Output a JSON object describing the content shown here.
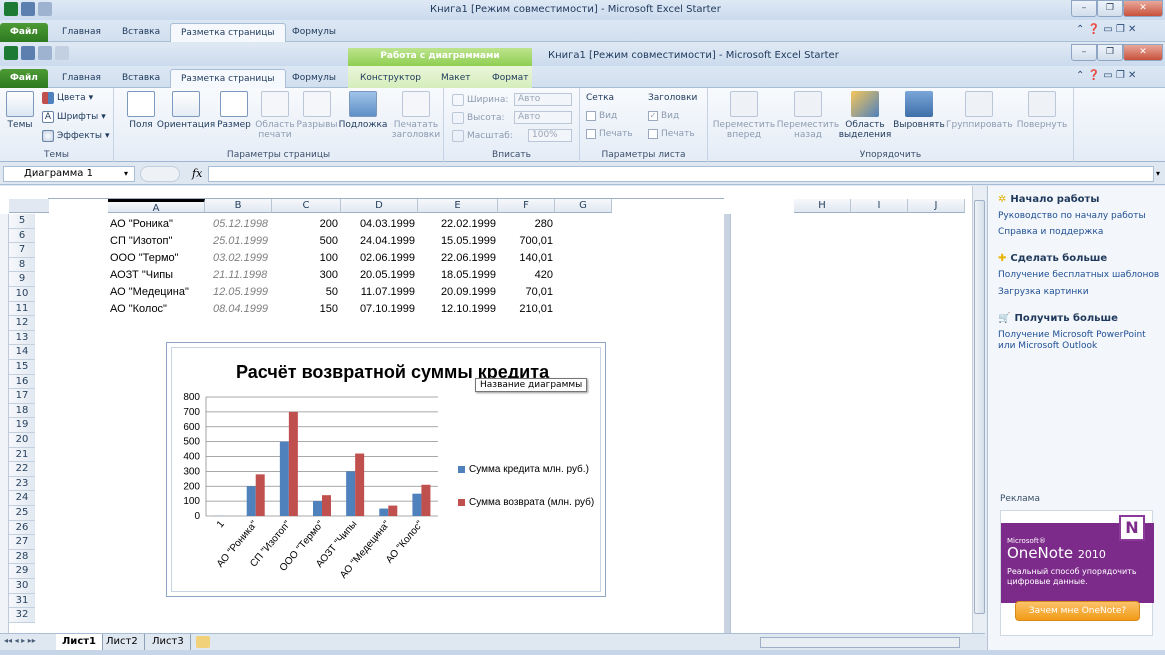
{
  "back_window": {
    "title": "Книга1  [Режим совместимости]  -  Microsoft Excel Starter",
    "tabs": [
      "Файл",
      "Главная",
      "Вставка",
      "Разметка страницы",
      "Формулы"
    ]
  },
  "window": {
    "title": "Книга1  [Режим совместимости]  -  Microsoft Excel Starter",
    "context_group": "Работа с диаграммами",
    "tabs": [
      "Файл",
      "Главная",
      "Вставка",
      "Разметка страницы",
      "Формулы"
    ],
    "context_tabs": [
      "Конструктор",
      "Макет",
      "Формат"
    ]
  },
  "ribbon": {
    "themes": {
      "label": "Темы",
      "big": "Темы",
      "colors": "Цвета",
      "fonts": "Шрифты",
      "effects": "Эффекты"
    },
    "page_setup": {
      "label": "Параметры страницы",
      "margins": "Поля",
      "orientation": "Ориентация",
      "size": "Размер",
      "print_area": "Область печати",
      "breaks": "Разрывы",
      "background": "Подложка",
      "print_titles": "Печатать заголовки"
    },
    "fit": {
      "label": "Вписать",
      "width": "Ширина:",
      "width_val": "Авто",
      "height": "Высота:",
      "height_val": "Авто",
      "scale": "Масштаб:",
      "scale_val": "100%"
    },
    "sheet_options": {
      "label": "Параметры листа",
      "grid": "Сетка",
      "headings": "Заголовки",
      "view": "Вид",
      "print": "Печать"
    },
    "arrange": {
      "label": "Упорядочить",
      "forward": "Переместить вперед",
      "backward": "Переместить назад",
      "selection": "Область выделения",
      "align": "Выровнять",
      "group": "Группировать",
      "rotate": "Повернуть"
    }
  },
  "formula_bar": {
    "name_box": "Диаграмма 1",
    "fx": "fx"
  },
  "columns": [
    "A",
    "B",
    "C",
    "D",
    "E",
    "F",
    "G",
    "H",
    "I",
    "J"
  ],
  "rows": [
    "5",
    "6",
    "7",
    "8",
    "9",
    "10",
    "11",
    "12",
    "13",
    "14",
    "15",
    "16",
    "17",
    "18",
    "19",
    "20",
    "21",
    "22",
    "23",
    "24",
    "25",
    "26",
    "27",
    "28",
    "29",
    "30",
    "31",
    "32"
  ],
  "table": [
    {
      "name": "АО \"Роника\"",
      "date1": "05.12.1998",
      "amount": "200",
      "date2": "04.03.1999",
      "date3": "22.02.1999",
      "ret": "280"
    },
    {
      "name": "СП \"Изотоп\"",
      "date1": "25.01.1999",
      "amount": "500",
      "date2": "24.04.1999",
      "date3": "15.05.1999",
      "ret": "700,01"
    },
    {
      "name": "ООО \"Термо\"",
      "date1": "03.02.1999",
      "amount": "100",
      "date2": "02.06.1999",
      "date3": "22.06.1999",
      "ret": "140,01"
    },
    {
      "name": "АОЗТ \"Чипы",
      "date1": "21.11.1998",
      "amount": "300",
      "date2": "20.05.1999",
      "date3": "18.05.1999",
      "ret": "420"
    },
    {
      "name": "АО \"Медецина\"",
      "date1": "12.05.1999",
      "amount": "50",
      "date2": "11.07.1999",
      "date3": "20.09.1999",
      "ret": "70,01"
    },
    {
      "name": "АО \"Колос\"",
      "date1": "08.04.1999",
      "amount": "150",
      "date2": "07.10.1999",
      "date3": "12.10.1999",
      "ret": "210,01"
    }
  ],
  "tooltip": "Название диаграммы",
  "chart_data": {
    "type": "bar",
    "title": "Расчёт возвратной суммы кредита",
    "categories": [
      "1",
      "АО \"Роника\"",
      "СП \"Изотоп\"",
      "ООО \"Термо\"",
      "АОЗТ \"Чипы",
      "АО \"Медецина\"",
      "АО \"Колос\""
    ],
    "series": [
      {
        "name": "Сумма кредита млн. руб.)",
        "color": "#4f81bd",
        "values": [
          1,
          200,
          500,
          100,
          300,
          50,
          150
        ]
      },
      {
        "name": "Сумма возврата (млн. руб)",
        "color": "#c0504d",
        "values": [
          0,
          280,
          700.01,
          140.01,
          420,
          70.01,
          210.01
        ]
      }
    ],
    "ylim": [
      0,
      800
    ],
    "yticks": [
      "0",
      "100",
      "200",
      "300",
      "400",
      "500",
      "600",
      "700",
      "800"
    ],
    "grid": true,
    "legend": "right"
  },
  "sheet_tabs": [
    "Лист1",
    "Лист2",
    "Лист3"
  ],
  "side_panel": {
    "h1": "Начало работы",
    "l1": [
      "Руководство по началу работы",
      "Справка и поддержка"
    ],
    "h2": "Сделать больше",
    "l2": [
      "Получение бесплатных шаблонов",
      "Загрузка картинки"
    ],
    "h3": "Получить больше",
    "l3": [
      "Получение Microsoft PowerPoint или Microsoft Outlook"
    ],
    "ad_label": "Реклама",
    "ad_brand_small": "Microsoft®",
    "ad_brand": "OneNote",
    "ad_year": "2010",
    "ad_text": "Реальный способ упорядочить цифровые данные.",
    "ad_button": "Зачем мне OneNote?"
  }
}
